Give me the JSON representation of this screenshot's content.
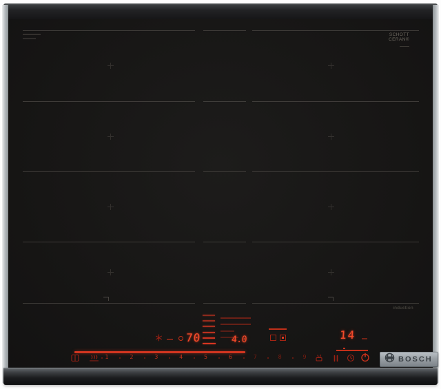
{
  "device": {
    "brand": "BOSCH",
    "type_label": "induction",
    "glass_brand_line1": "SCHOTT",
    "glass_brand_line2": "CERAN®"
  },
  "control_panel": {
    "fry_sensor_temp": "70",
    "power_level": "4.0",
    "timer_minutes": "14",
    "slider_levels": [
      "1",
      "2",
      "3",
      "4",
      "5",
      "6",
      "7",
      "8",
      "9"
    ],
    "active_level_end": 6,
    "fry_level_bar_count": 6,
    "icons_left": [
      "flex-zone-icon",
      "fry-sensor-icon"
    ],
    "icons_right": [
      "cleaning-protection-icon",
      "pause-icon",
      "timer-icon",
      "power-icon"
    ]
  },
  "colors": {
    "led_bright": "#f34a2a",
    "led_mid": "#c23019",
    "led_dim": "#8f1d12",
    "glass": "#171615",
    "badge_text": "#3b4146",
    "zone_line": "#4a4642"
  }
}
